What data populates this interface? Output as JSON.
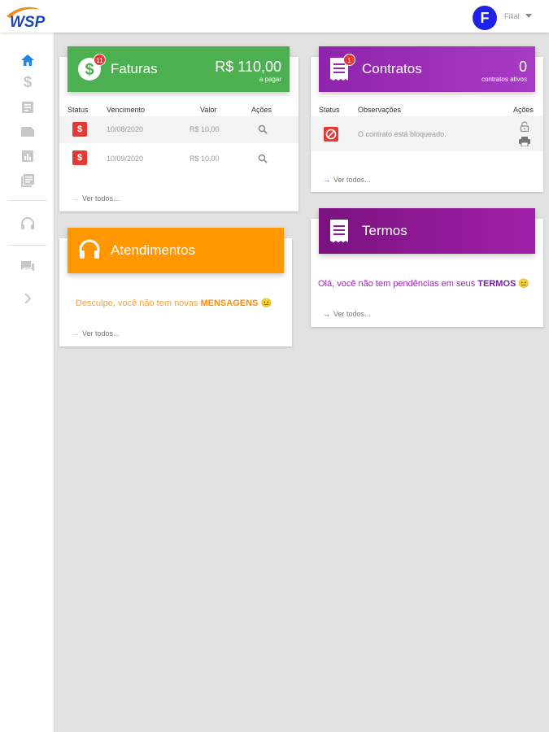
{
  "brand": {
    "logo_text": "WSP",
    "logo_color": "#1f4aa8",
    "swoosh_color": "#f08a1c"
  },
  "user": {
    "initial": "F",
    "name": "Filial"
  },
  "sidebar": {
    "items": [
      {
        "icon": "home-icon",
        "active": true
      },
      {
        "icon": "dollar-icon"
      },
      {
        "icon": "document-icon"
      },
      {
        "icon": "folder-icon"
      },
      {
        "icon": "bar-chart-icon"
      },
      {
        "icon": "news-icon"
      },
      {
        "icon": "headset-icon"
      },
      {
        "icon": "chat-icon"
      },
      {
        "icon": "chevron-right-icon"
      }
    ]
  },
  "faturas": {
    "title": "Faturas",
    "badge": "11",
    "amount": "R$ 110,00",
    "amount_sub": "a pagar",
    "color": "#4caf50",
    "columns": [
      "Status",
      "Vencimento",
      "Valor",
      "Ações"
    ],
    "rows": [
      {
        "status_icon": "$",
        "vencimento": "10/08/2020",
        "valor": "R$ 10,00"
      },
      {
        "status_icon": "$",
        "vencimento": "10/09/2020",
        "valor": "R$ 10,00"
      }
    ],
    "ver_todos": "Ver todos..."
  },
  "contratos": {
    "title": "Contratos",
    "badge": "1",
    "count": "0",
    "count_sub": "contratos ativos",
    "color": "#9c27b0",
    "columns": [
      "Status",
      "Observações",
      "Ações"
    ],
    "rows": [
      {
        "observacao": "O contrato está bloqueado."
      }
    ],
    "ver_todos": "Ver todos..."
  },
  "atendimentos": {
    "title": "Atendimentos",
    "color": "#ff9800",
    "message_prefix": "Desculpe, você não tem novas ",
    "message_strong": "MENSAGENS",
    "message_emoji": "😐",
    "ver_todos": "Ver todos..."
  },
  "termos": {
    "title": "Termos",
    "color": "#8b1a9a",
    "message_prefix": "Olá, você não tem pendências em seus ",
    "message_strong": "TERMOS",
    "message_emoji": "😐",
    "ver_todos": "Ver todos..."
  }
}
